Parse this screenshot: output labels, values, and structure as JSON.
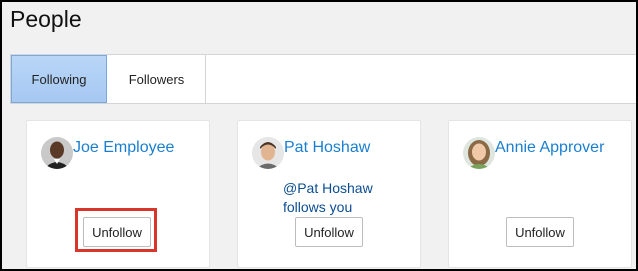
{
  "page": {
    "title": "People"
  },
  "tabs": [
    {
      "label": "Following",
      "active": true
    },
    {
      "label": "Followers",
      "active": false
    }
  ],
  "people": [
    {
      "name": "Joe Employee",
      "follows_line1": "",
      "follows_line2": "",
      "button": "Unfollow"
    },
    {
      "name": "Pat Hoshaw",
      "follows_line1": "@Pat Hoshaw",
      "follows_line2": "follows you",
      "button": "Unfollow"
    },
    {
      "name": "Annie Approver",
      "follows_line1": "",
      "follows_line2": "",
      "button": "Unfollow"
    }
  ],
  "colors": {
    "link": "#1a7fd1",
    "follows_text": "#0b4d92",
    "active_tab": "#a6c8f2",
    "highlight": "#d9362b"
  },
  "icons": [
    "avatar-joe-employee",
    "avatar-pat-hoshaw",
    "avatar-annie-approver"
  ]
}
